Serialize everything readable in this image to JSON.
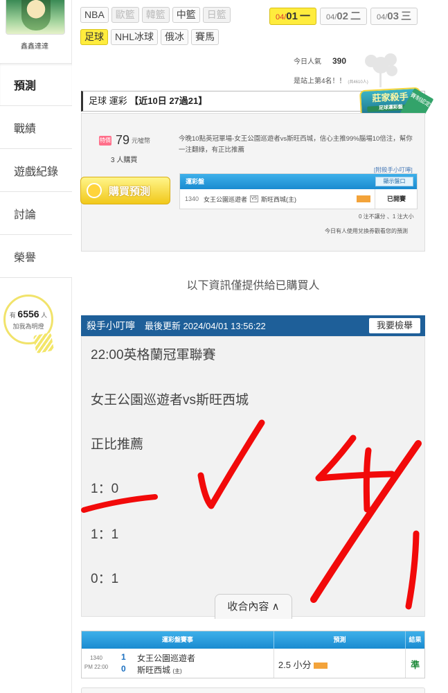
{
  "user": {
    "name": "鑫鑫達達"
  },
  "nav": [
    {
      "label": "預測"
    },
    {
      "label": "戰績"
    },
    {
      "label": "遊戲紀錄"
    },
    {
      "label": "討論"
    },
    {
      "label": "榮譽"
    }
  ],
  "fans": {
    "prefix": "有",
    "count": "6556",
    "suffix": "人",
    "action": "加我為明燈"
  },
  "sports_row1": [
    "NBA",
    "歐籃",
    "韓籃",
    "中籃",
    "日籃"
  ],
  "sports_row2": [
    "足球",
    "NHL冰球",
    "俄冰",
    "賽馬"
  ],
  "dates": [
    {
      "month": "04/",
      "day": "01",
      "weekday": "一"
    },
    {
      "month": "04/",
      "day": "02",
      "weekday": "二"
    },
    {
      "month": "04/",
      "day": "03",
      "weekday": "三"
    }
  ],
  "popularity": {
    "label": "今日人氣",
    "value": "390"
  },
  "rank": {
    "text": "是站上第4名！！",
    "small": "(共4610人)"
  },
  "prediction": {
    "header_sport": "足球 運彩",
    "header_record": "【近10日 27過21】",
    "badge_title": "莊家殺手",
    "badge_sub": "足球運彩盤",
    "ribbon": "賽制認定",
    "sale_tag": "特價",
    "price": "79",
    "price_unit": "元噓幣",
    "buyers": "3 人購買",
    "buy_button": "購買預測",
    "description": "今晚10點英冠單場-女王公園巡遊者vs斯旺西城，信心主推99%腦場10倍注，幫你一注翻綠，有正比推薦",
    "odds_link": "[附殺手小叮嚀]",
    "odds_header": "運彩盤",
    "odds_show": "顯示盤口",
    "game_no": "1340",
    "away_team": "女王公園巡遊者",
    "vs": "VS",
    "home_team": "斯旺西城(主)",
    "status": "已開賽",
    "note1": "0 注不讓分 、1 注大小",
    "note2": "今日有人使用兌換券觀看您的預測"
  },
  "buyer_only": "以下資訊僅提供給已購買人",
  "hint": {
    "title": "殺手小叮嚀",
    "updated": "最後更新 2024/04/01 13:56:22",
    "report": "我要檢舉",
    "lines": [
      "22:00英格蘭冠軍聯賽",
      "女王公園巡遊者vs斯旺西城",
      "正比推薦",
      "1：0",
      "1：1",
      "0：1"
    ],
    "collapse": "收合內容 ∧"
  },
  "results": {
    "headers": [
      "運彩盤賽事",
      "預測",
      "結果"
    ],
    "game_no": "1340",
    "game_time": "PM 22:00",
    "team1_score": "1",
    "team1": "女王公園巡遊者",
    "team2_score": "0",
    "team2": "斯旺西城",
    "team2_suffix": "(主)",
    "prediction": "2.5 小分",
    "result": "準"
  },
  "colors": {
    "accent_yellow": "#ffec3d",
    "header_blue": "#1e5f99",
    "table_blue": "#1a8bd0",
    "handwriting_red": "#f20a0a"
  }
}
